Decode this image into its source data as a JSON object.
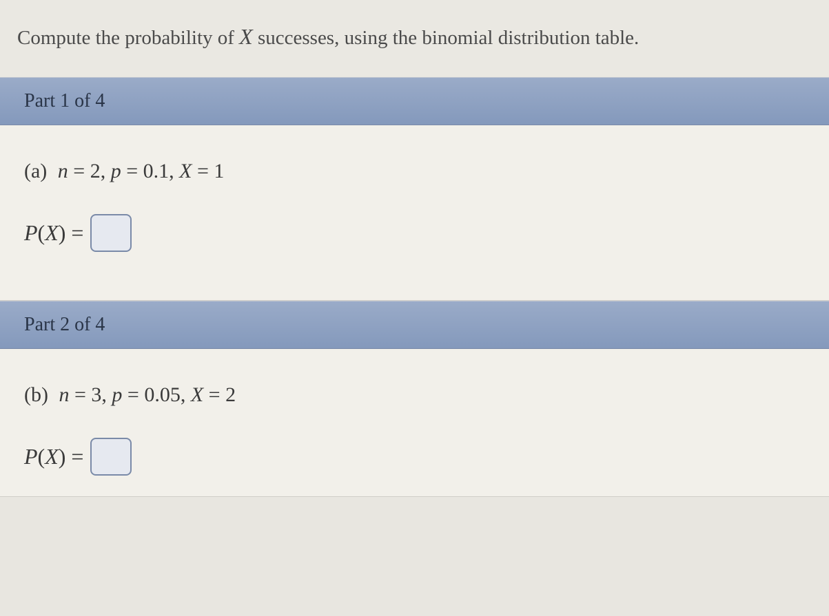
{
  "intro": {
    "prefix": "Compute the probability of ",
    "variable": "X",
    "suffix": " successes, using the binomial distribution table."
  },
  "parts": [
    {
      "header": "Part 1 of 4",
      "label": "(a)",
      "params_n_var": "n",
      "params_n_eq": " = 2, ",
      "params_p_var": "p",
      "params_p_eq": " = 0.1, ",
      "params_x_var": "X",
      "params_x_eq": " = 1",
      "answer_p": "P",
      "answer_paren_open": " (",
      "answer_x": "X",
      "answer_paren_close": " ) = ",
      "answer_value": ""
    },
    {
      "header": "Part 2 of 4",
      "label": "(b)",
      "params_n_var": "n",
      "params_n_eq": " = 3, ",
      "params_p_var": "p",
      "params_p_eq": " = 0.05, ",
      "params_x_var": "X",
      "params_x_eq": " = 2",
      "answer_p": "P",
      "answer_paren_open": " (",
      "answer_x": "X",
      "answer_paren_close": " ) = ",
      "answer_value": ""
    }
  ]
}
